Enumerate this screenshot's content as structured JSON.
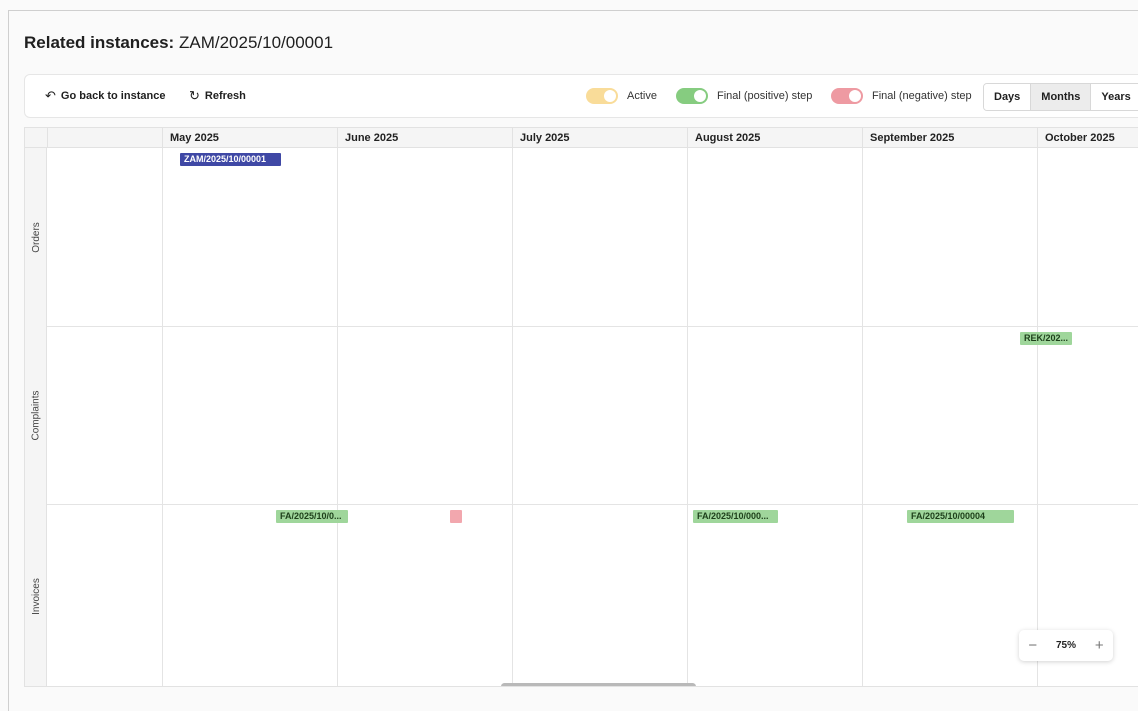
{
  "title": {
    "label": "Related instances:",
    "value": "ZAM/2025/10/00001"
  },
  "toolbar": {
    "back_label": "Go back to instance",
    "refresh_label": "Refresh",
    "legend": {
      "active": "Active",
      "positive": "Final (positive) step",
      "negative": "Final (negative) step"
    },
    "views": [
      "Days",
      "Months",
      "Years"
    ],
    "selected_view": "Months"
  },
  "colors": {
    "active_toggle": "#f9dc99",
    "positive_toggle": "#86cc80",
    "negative_toggle": "#ee9aa2",
    "active_bar": "#3f48a5",
    "positive_bar": "#9fd69b",
    "negative_bar": "#f2a7ae"
  },
  "timeline": {
    "months": [
      "May 2025",
      "June 2025",
      "July 2025",
      "August 2025",
      "September 2025",
      "October 2025"
    ],
    "rows": [
      "Orders",
      "Complaints",
      "Invoices"
    ],
    "items": {
      "order1": "ZAM/2025/10/00001",
      "complaint1": "REK/202...",
      "invoice1": "FA/2025/10/0...",
      "invoice2": "",
      "invoice3": "FA/2025/10/000...",
      "invoice4": "FA/2025/10/00004"
    }
  },
  "zoom": {
    "minus": "−",
    "value": "75%",
    "plus": "+"
  }
}
